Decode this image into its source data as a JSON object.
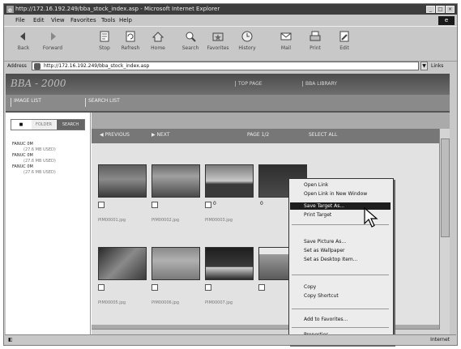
{
  "window": {
    "title": "http://172.16.192.249/bba_stock_index.asp - Microsoft Internet Explorer"
  },
  "menu": [
    "File",
    "Edit",
    "View",
    "Favorites",
    "Tools",
    "Help"
  ],
  "toolbar": [
    {
      "label": "Back",
      "icon": "back-arrow-icon"
    },
    {
      "label": "Forward",
      "icon": "forward-arrow-icon"
    },
    {
      "label": "Stop",
      "icon": "stop-icon"
    },
    {
      "label": "Refresh",
      "icon": "refresh-icon"
    },
    {
      "label": "Home",
      "icon": "home-icon"
    },
    {
      "label": "Search",
      "icon": "search-icon"
    },
    {
      "label": "Favorites",
      "icon": "favorites-icon"
    },
    {
      "label": "History",
      "icon": "history-icon"
    },
    {
      "label": "Mail",
      "icon": "mail-icon"
    },
    {
      "label": "Print",
      "icon": "print-icon"
    },
    {
      "label": "Edit",
      "icon": "edit-icon"
    }
  ],
  "address": {
    "label": "Address",
    "value": "http://172.16.192.249/bba_stock_index.asp",
    "links": "Links"
  },
  "banner": {
    "logo": "BBA - 2000",
    "nav": [
      "TOP PAGE",
      "BBA LIBRARY"
    ]
  },
  "nav2": {
    "tabs": [
      "IMAGE LIST",
      "SEARCH LIST"
    ]
  },
  "left_panel": {
    "buttons": [
      "■",
      "FOLDER",
      "SEARCH"
    ],
    "tree": [
      {
        "drive": "FANUC 0M",
        "size": "(27.6 MB USED)"
      },
      {
        "drive": "FANUC 0M",
        "size": "(27.6 MB USED)"
      },
      {
        "drive": "FANUC 0M",
        "size": "(27.6 MB USED)"
      }
    ]
  },
  "controls": [
    "◀ PREVIOUS",
    "▶ NEXT",
    "PAGE 1/2",
    "SELECT ALL"
  ],
  "thumbnails": [
    {
      "file": "PIM00001.jpg",
      "count": ""
    },
    {
      "file": "PIM00002.jpg",
      "count": ""
    },
    {
      "file": "PIM00003.jpg",
      "count": "0"
    },
    {
      "file": "",
      "count": "0"
    },
    {
      "file": "PIM00005.jpg",
      "count": ""
    },
    {
      "file": "PIM00006.jpg",
      "count": ""
    },
    {
      "file": "PIM00007.jpg",
      "count": ""
    },
    {
      "file": "",
      "count": ""
    }
  ],
  "context_menu": [
    "Open Link",
    "Open Link in New Window",
    "Save Target As...",
    "Print Target",
    "Save Picture As...",
    "Set as Wallpaper",
    "Set as Desktop Item...",
    "Copy",
    "Copy Shortcut",
    "Add to Favorites...",
    "Properties"
  ],
  "status": {
    "zone": "Internet"
  }
}
